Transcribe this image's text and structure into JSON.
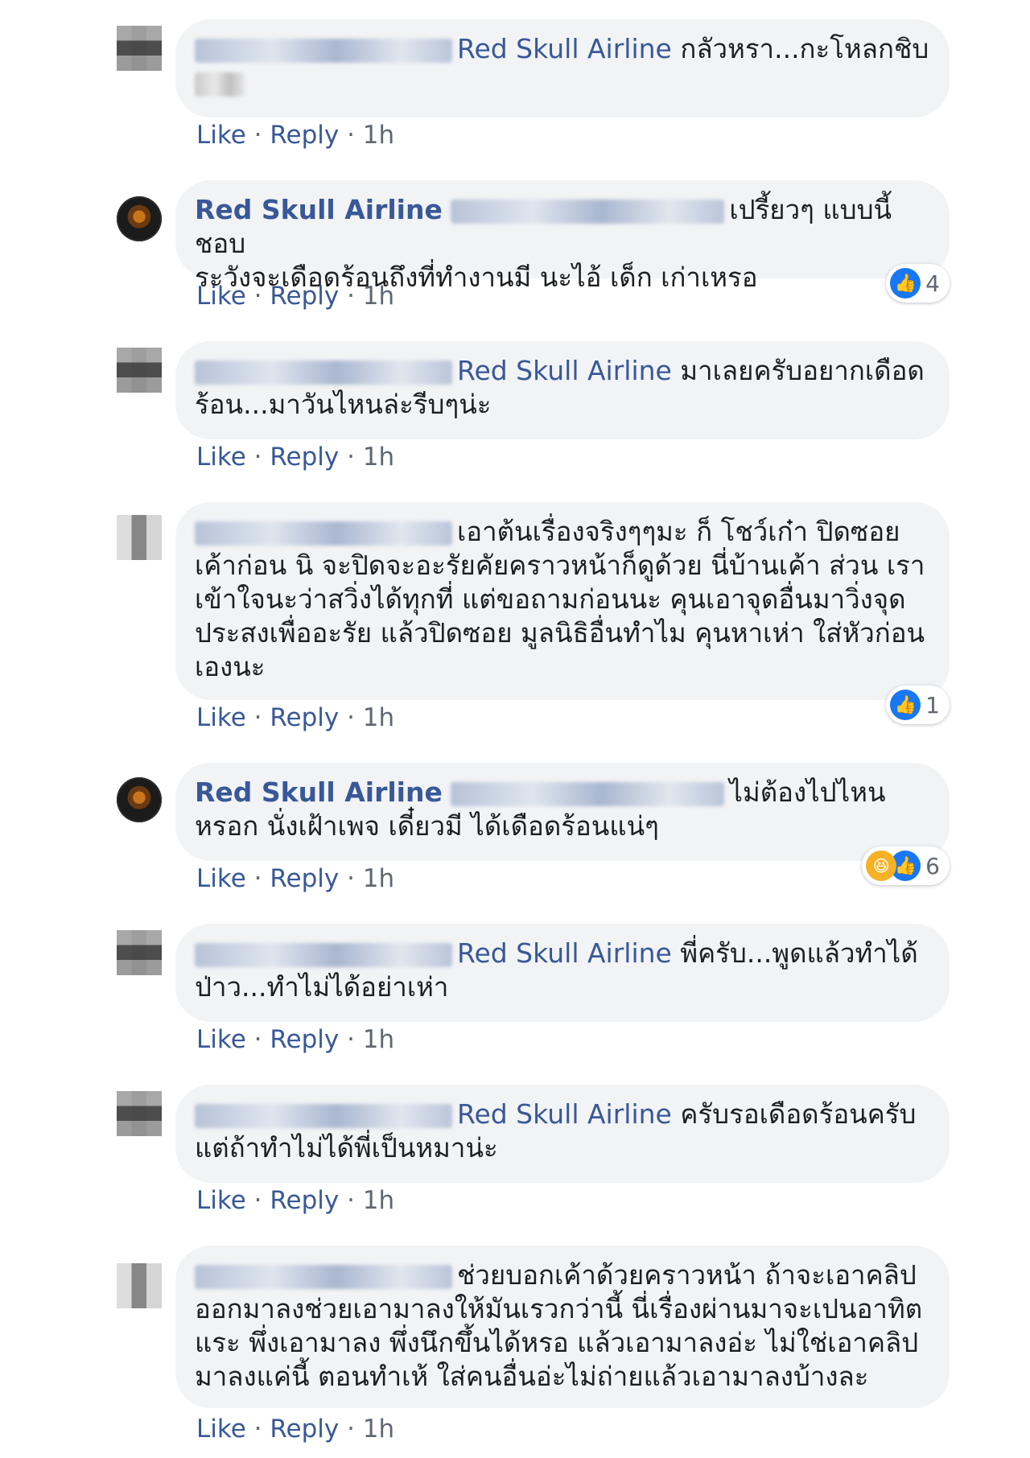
{
  "comments": [
    {
      "author": "",
      "mention": "Red Skull Airline",
      "text": "กลัวหรา...กะโหลกชิบ",
      "actions": {
        "like": "Like",
        "reply": "Reply",
        "time": "1h"
      }
    },
    {
      "author": "Red Skull Airline",
      "text_line1": "เปรี้ยวๆ แบบนี้ ชอบ",
      "text_line2": "ระวังจะเดือดร้อนถึงที่ทำงานมี นะไอ้ เด็ก เก่าเหรอ",
      "actions": {
        "like": "Like",
        "reply": "Reply",
        "time": "1h"
      },
      "reaction_count": "4"
    },
    {
      "author": "",
      "mention": "Red Skull Airline",
      "text": "มาเลยครับอยากเดือดร้อน...มาวันไหนล่ะรีบๆน่ะ",
      "actions": {
        "like": "Like",
        "reply": "Reply",
        "time": "1h"
      }
    },
    {
      "author": "",
      "text": "เอาต้นเรื่องจริงๆๆมะ ก็ โชว์เก๋า ปิดซอยเค้าก่อน นิ จะปิดจะอะรัยคัยคราวหน้าก็ดูด้วย นี่บ้านเค้า ส่วน เราเข้าใจนะว่าสวิ่งได้ทุกที่ แต่ขอถามก่อนนะ คุนเอาจุดอื่นมาวิ่งจุดประสงเพื่ออะรัย แล้วปิดซอย มูลนิธิอื่นทำไม คุนหาเห่า ใส่หัวก่อนเองนะ",
      "actions": {
        "like": "Like",
        "reply": "Reply",
        "time": "1h"
      },
      "reaction_count": "1"
    },
    {
      "author": "Red Skull Airline",
      "text": "ไม่ต้องไปไหนหรอก นั่งเฝ้าเพจ เดี๋ยวมี ได้เดือดร้อนแน่ๆ",
      "actions": {
        "like": "Like",
        "reply": "Reply",
        "time": "1h"
      },
      "reaction_count": "6"
    },
    {
      "author": "",
      "mention": "Red Skull Airline",
      "text": "พี่ครับ...พูดแล้วทำได้ป่าว...ทำไม่ได้อย่าเห่า",
      "actions": {
        "like": "Like",
        "reply": "Reply",
        "time": "1h"
      }
    },
    {
      "author": "",
      "mention": "Red Skull Airline",
      "text": "ครับรอเดือดร้อนครับ แต่ถ้าทำไม่ได้พี่เป็นหมาน่ะ",
      "actions": {
        "like": "Like",
        "reply": "Reply",
        "time": "1h"
      }
    },
    {
      "author": "",
      "text": "ช่วยบอกเค้าด้วยคราวหน้า ถ้าจะเอาคลิปออกมาลงช่วยเอามาลงให้มันเรวกว่านี้ นี่เรื่องผ่านมาจะเปนอาทิตแระ พึ่งเอามาลง พึ่งนึกขึ้นได้หรอ แล้วเอามาลงอ่ะ ไม่ใช่เอาคลิปมาลงแค่นี้ ตอนทำเห้ ใส่คนอื่นอ่ะไม่ถ่ายแล้วเอามาลงบ้างละ",
      "actions": {
        "like": "Like",
        "reply": "Reply",
        "time": "1h"
      }
    }
  ]
}
